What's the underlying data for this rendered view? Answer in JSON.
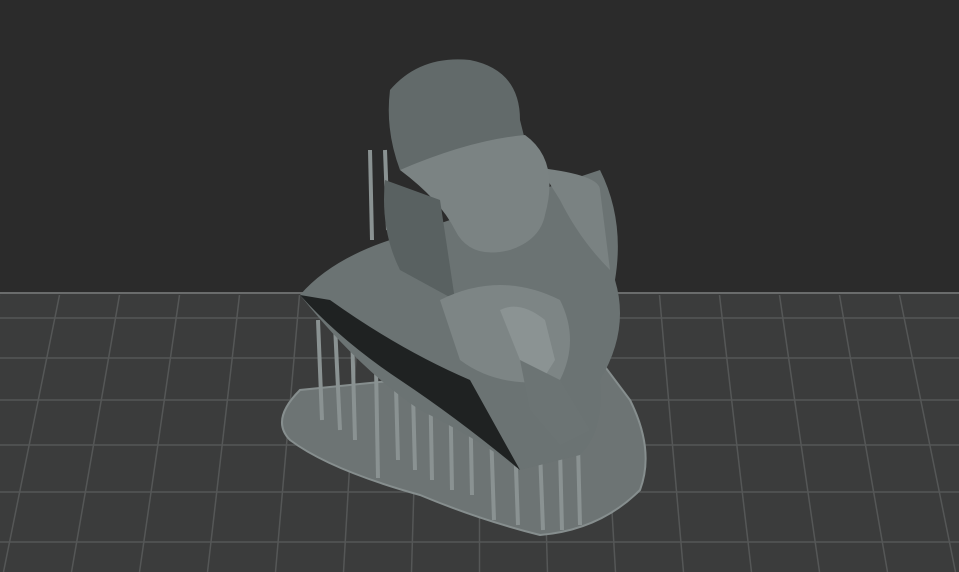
{
  "viewport": {
    "background_color": "#2b2b2b",
    "build_plate_color": "#3b3c3c",
    "grid_line_color": "#555757",
    "model_color": "#6f7777",
    "raft_color": "#7b8383"
  },
  "model": {
    "icon": "3d-model-bust-with-supports"
  }
}
